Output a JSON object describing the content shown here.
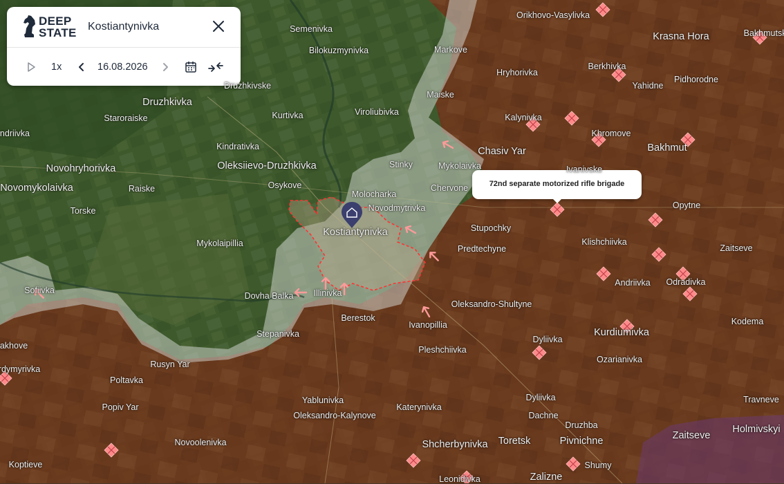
{
  "app": {
    "logo_line1": "DEEP",
    "logo_line2": "STATE",
    "title": "Kostiantynivka"
  },
  "controls": {
    "speed": "1x",
    "date": "16.08.2026"
  },
  "icons": [
    "horse-logo-icon",
    "close-icon",
    "play-icon",
    "prev-icon",
    "next-icon",
    "calendar-icon",
    "collapse-icon",
    "city-marker-icon",
    "unit-marker-icon",
    "attack-arrow-icon"
  ],
  "colors": {
    "occupied": "#7a2e18",
    "gray_zone": "#d8dcd8",
    "liberated_forest": "#2f4a22",
    "city_boundary": "#ff3333",
    "unit_marker": "#ff8a8a",
    "arrow": "#ff9a9a",
    "special_zone": "#6a3a6a"
  },
  "tooltip": {
    "text": "72nd separate motorized rifle brigade"
  },
  "places": [
    {
      "name": "Semenivka"
    },
    {
      "name": "Orikhovo-Vasylivka"
    },
    {
      "name": "Krasna Hora",
      "big": true
    },
    {
      "name": "Bakhmutske"
    },
    {
      "name": "Bilokuzmynivka"
    },
    {
      "name": "Markove"
    },
    {
      "name": "Druzhkivske"
    },
    {
      "name": "Hryhorivka"
    },
    {
      "name": "Berkhivka"
    },
    {
      "name": "Yahidne"
    },
    {
      "name": "Pidhorodne"
    },
    {
      "name": "Druzhkivka",
      "big": true
    },
    {
      "name": "Maiske"
    },
    {
      "name": "Staroraiske"
    },
    {
      "name": "Kurtivka"
    },
    {
      "name": "Viroliubivka"
    },
    {
      "name": "Kalynivka"
    },
    {
      "name": "Khromove"
    },
    {
      "name": "Bakhmut",
      "big": true
    },
    {
      "name": "andriivka"
    },
    {
      "name": "Kindrativka"
    },
    {
      "name": "Chasiv Yar",
      "big": true
    },
    {
      "name": "Novohryhorivka",
      "big": true
    },
    {
      "name": "Oleksiievo-Druzhkivka",
      "big": true
    },
    {
      "name": "Stinky"
    },
    {
      "name": "Mykolaivka"
    },
    {
      "name": "Ivanivske"
    },
    {
      "name": "Novomykolaivka",
      "big": true
    },
    {
      "name": "Raiske"
    },
    {
      "name": "Osykove"
    },
    {
      "name": "Chervone"
    },
    {
      "name": "Molocharka"
    },
    {
      "name": "Torske"
    },
    {
      "name": "Novodmytrivka"
    },
    {
      "name": "Opytne"
    },
    {
      "name": "Stupochky"
    },
    {
      "name": "Kostiantynivka",
      "big": true
    },
    {
      "name": "Mykolaipillia"
    },
    {
      "name": "Predtechyne"
    },
    {
      "name": "Klishchiivka"
    },
    {
      "name": "Zaitseve"
    },
    {
      "name": "Andriivka"
    },
    {
      "name": "Odradivka"
    },
    {
      "name": "Sofiivka"
    },
    {
      "name": "Dovha Balka"
    },
    {
      "name": "Illinivka"
    },
    {
      "name": "Oleksandro-Shultyne"
    },
    {
      "name": "Berestok"
    },
    {
      "name": "Ivanopillia"
    },
    {
      "name": "Kodema"
    },
    {
      "name": "akhove"
    },
    {
      "name": "Stepanivka"
    },
    {
      "name": "Kurdiumivka",
      "big": true
    },
    {
      "name": "Dyliivka"
    },
    {
      "name": "Pleshchiivka"
    },
    {
      "name": "rdymyrivka"
    },
    {
      "name": "Rusyn Yar"
    },
    {
      "name": "Ozarianivka"
    },
    {
      "name": "Poltavka"
    },
    {
      "name": "Yablunivka"
    },
    {
      "name": "Dyliivka"
    },
    {
      "name": "Travneve"
    },
    {
      "name": "Popiv Yar"
    },
    {
      "name": "Katerynivka"
    },
    {
      "name": "Oleksandro-Kalynove"
    },
    {
      "name": "Dachne"
    },
    {
      "name": "Druzhba"
    },
    {
      "name": "Zaitseve",
      "big": true
    },
    {
      "name": "Holmivskyi",
      "big": true
    },
    {
      "name": "Novoolenivka"
    },
    {
      "name": "Shcherbynivka",
      "big": true
    },
    {
      "name": "Toretsk",
      "big": true
    },
    {
      "name": "Pivnichne",
      "big": true
    },
    {
      "name": "Koptieve"
    },
    {
      "name": "Shumy"
    },
    {
      "name": "Zalizne",
      "big": true
    },
    {
      "name": "Leonidivka"
    }
  ]
}
